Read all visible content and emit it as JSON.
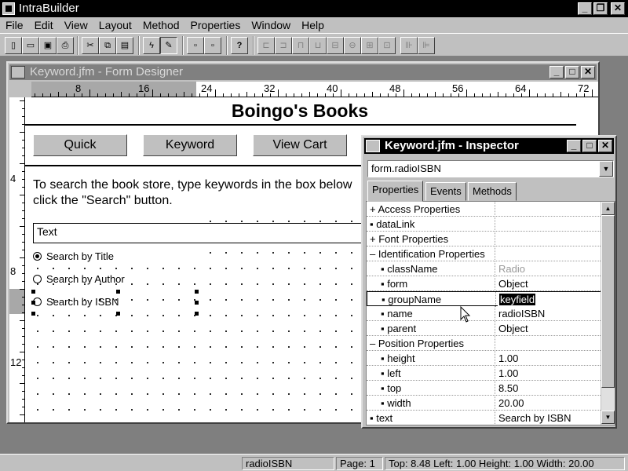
{
  "app": {
    "title": "IntraBuilder"
  },
  "menu": [
    "File",
    "Edit",
    "View",
    "Layout",
    "Method",
    "Properties",
    "Window",
    "Help"
  ],
  "toolbar": {
    "help_label": "?"
  },
  "designer": {
    "title": "Keyword.jfm - Form Designer",
    "ruler_h": [
      "8",
      "16",
      "24",
      "32",
      "40",
      "48",
      "56",
      "64",
      "72"
    ],
    "ruler_v": [
      "4",
      "8",
      "12"
    ],
    "form": {
      "title": "Boingo's Books",
      "buttons": [
        "Quick",
        "Keyword",
        "View Cart"
      ],
      "instructions_line1": "To search the book store, type keywords in the box below",
      "instructions_line2": "click the \"Search\" button.",
      "text_field": "Text",
      "radios": [
        {
          "label": "Search by Title",
          "checked": true
        },
        {
          "label": "Search by Author",
          "checked": false
        },
        {
          "label": "Search by ISBN",
          "checked": false
        }
      ]
    }
  },
  "inspector": {
    "title": "Keyword.jfm - Inspector",
    "object": "form.radioISBN",
    "tabs": [
      "Properties",
      "Events",
      "Methods"
    ],
    "active_tab": "Properties",
    "rows": [
      {
        "name": "+ Access Properties",
        "value": ""
      },
      {
        "name": "▪ dataLink",
        "value": ""
      },
      {
        "name": "+ Font Properties",
        "value": ""
      },
      {
        "name": "– Identification Properties",
        "value": ""
      },
      {
        "name": "▪ className",
        "value": "Radio"
      },
      {
        "name": "▪ form",
        "value": "Object"
      },
      {
        "name": "▪ groupName",
        "value": "keyfield"
      },
      {
        "name": "▪ name",
        "value": "radioISBN"
      },
      {
        "name": "▪ parent",
        "value": "Object"
      },
      {
        "name": "– Position Properties",
        "value": ""
      },
      {
        "name": "▪ height",
        "value": "1.00"
      },
      {
        "name": "▪ left",
        "value": "1.00"
      },
      {
        "name": "▪ top",
        "value": "8.50"
      },
      {
        "name": "▪ width",
        "value": "20.00"
      },
      {
        "name": "▪ text",
        "value": "Search by ISBN"
      }
    ]
  },
  "status": {
    "object": "radioISBN",
    "page": "Page: 1",
    "geometry": "Top: 8.48 Left: 1.00 Height: 1.00 Width: 20.00"
  }
}
